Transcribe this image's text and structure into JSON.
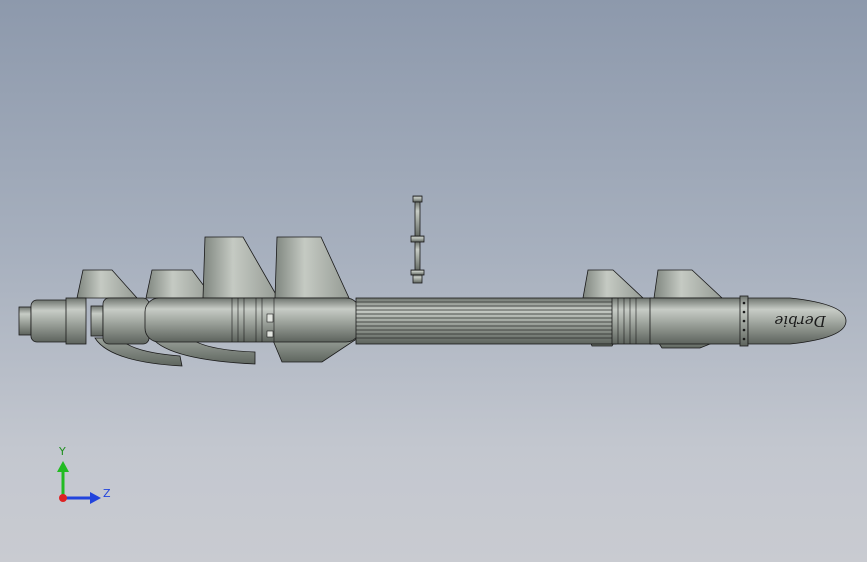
{
  "viewport": {
    "model": "missile-launcher-assembly",
    "triad": {
      "y_label": "Y",
      "z_label": "Z"
    },
    "nose_engraving": "Derbie",
    "colors": {
      "background_top": "#8d99ac",
      "background_bottom": "#c9cbd1",
      "body": "#9aa09a",
      "body_light": "#c3c8c2",
      "edge": "#1a1a1a",
      "axis_y": "#22bb22",
      "axis_z": "#2244dd",
      "axis_origin": "#dd2222"
    }
  }
}
